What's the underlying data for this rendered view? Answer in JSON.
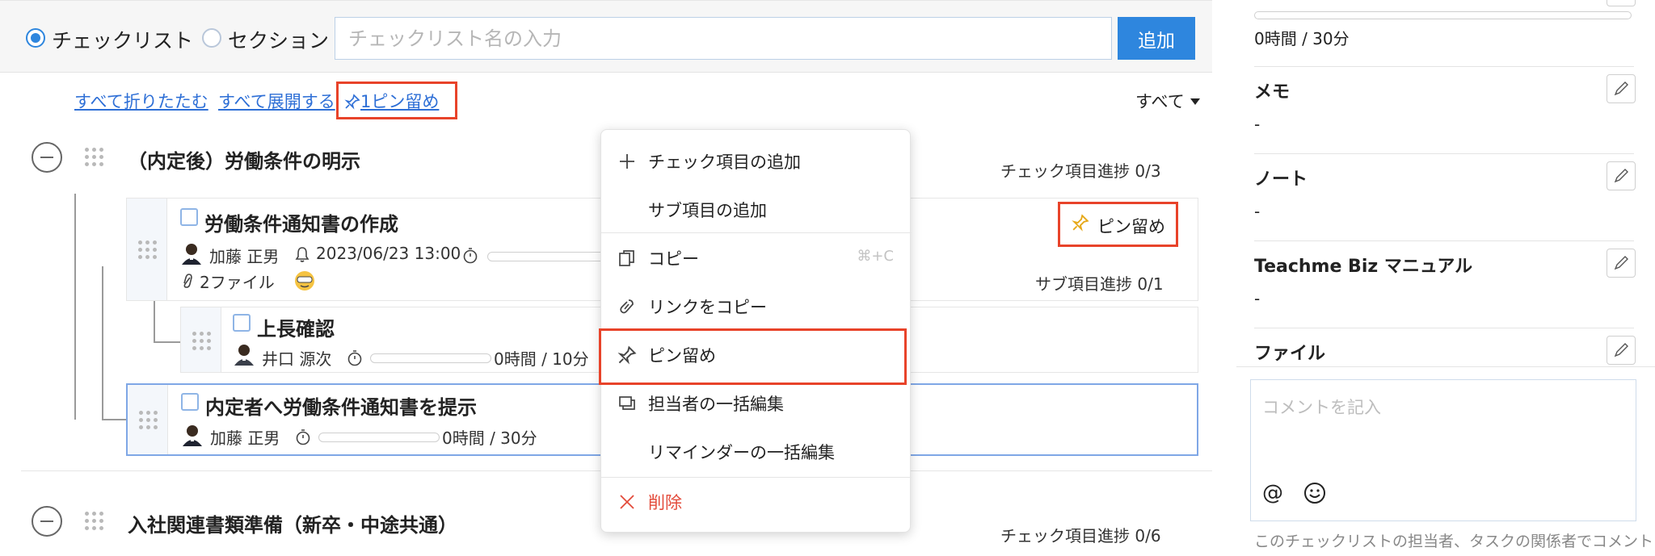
{
  "topbar": {
    "radio_checklist": "チェックリスト",
    "radio_section": "セクション",
    "input_placeholder": "チェックリスト名の入力",
    "add_label": "追加"
  },
  "links": {
    "collapse_all": "すべて折りたたむ",
    "expand_all": "すべて展開する",
    "pinned_filter": "1ピン留め",
    "filter_all": "すべて"
  },
  "sections": [
    {
      "title": "（内定後）労働条件の明示",
      "progress": "チェック項目進捗 0/3",
      "items": [
        {
          "title": "労働条件通知書の作成",
          "assignee": "加藤 正男",
          "reminder": "2023/06/23 13:00",
          "files": "2ファイル",
          "pin_label": "ピン留め",
          "sub_progress": "サブ項目進捗 0/1",
          "subitems": [
            {
              "title": "上長確認",
              "assignee": "井口 源次",
              "time": "0時間 / 10分"
            }
          ]
        },
        {
          "title": "内定者へ労働条件通知書を提示",
          "assignee": "加藤 正男",
          "time": "0時間 / 30分"
        }
      ]
    },
    {
      "title": "入社関連書類準備（新卒・中途共通）",
      "progress": "チェック項目進捗 0/6"
    }
  ],
  "context_menu": {
    "add_check_item": "チェック項目の追加",
    "add_sub_item": "サブ項目の追加",
    "copy": "コピー",
    "copy_shortcut": "⌘+C",
    "copy_link": "リンクをコピー",
    "pin": "ピン留め",
    "bulk_edit_assignee": "担当者の一括編集",
    "bulk_edit_reminder": "リマインダーの一括編集",
    "delete": "削除"
  },
  "right_panel": {
    "time": "0時間 / 30分",
    "memo_label": "メモ",
    "memo_value": "-",
    "note_label": "ノート",
    "note_value": "-",
    "manual_label": "Teachme Biz マニュアル",
    "manual_value": "-",
    "file_label": "ファイル",
    "comment_placeholder": "コメントを記入",
    "at_symbol": "@",
    "comment_note": "このチェックリストの担当者、タスクの関係者でコメント"
  },
  "colors": {
    "accent": "#2e86de",
    "highlight_red": "#e8432a",
    "pin_gold": "#e6a817",
    "delete_red": "#e34b3b",
    "link_blue": "#2e6fd6"
  },
  "icons": {
    "pin": "pin-icon",
    "bell": "bell-icon",
    "timer": "timer-icon",
    "clip": "paperclip-icon",
    "plus": "plus-icon",
    "copy": "copy-icon",
    "link": "link-icon",
    "assignee": "assignee-edit-icon",
    "delete": "close-icon",
    "edit": "pencil-icon",
    "emoji": "emoji-icon"
  }
}
